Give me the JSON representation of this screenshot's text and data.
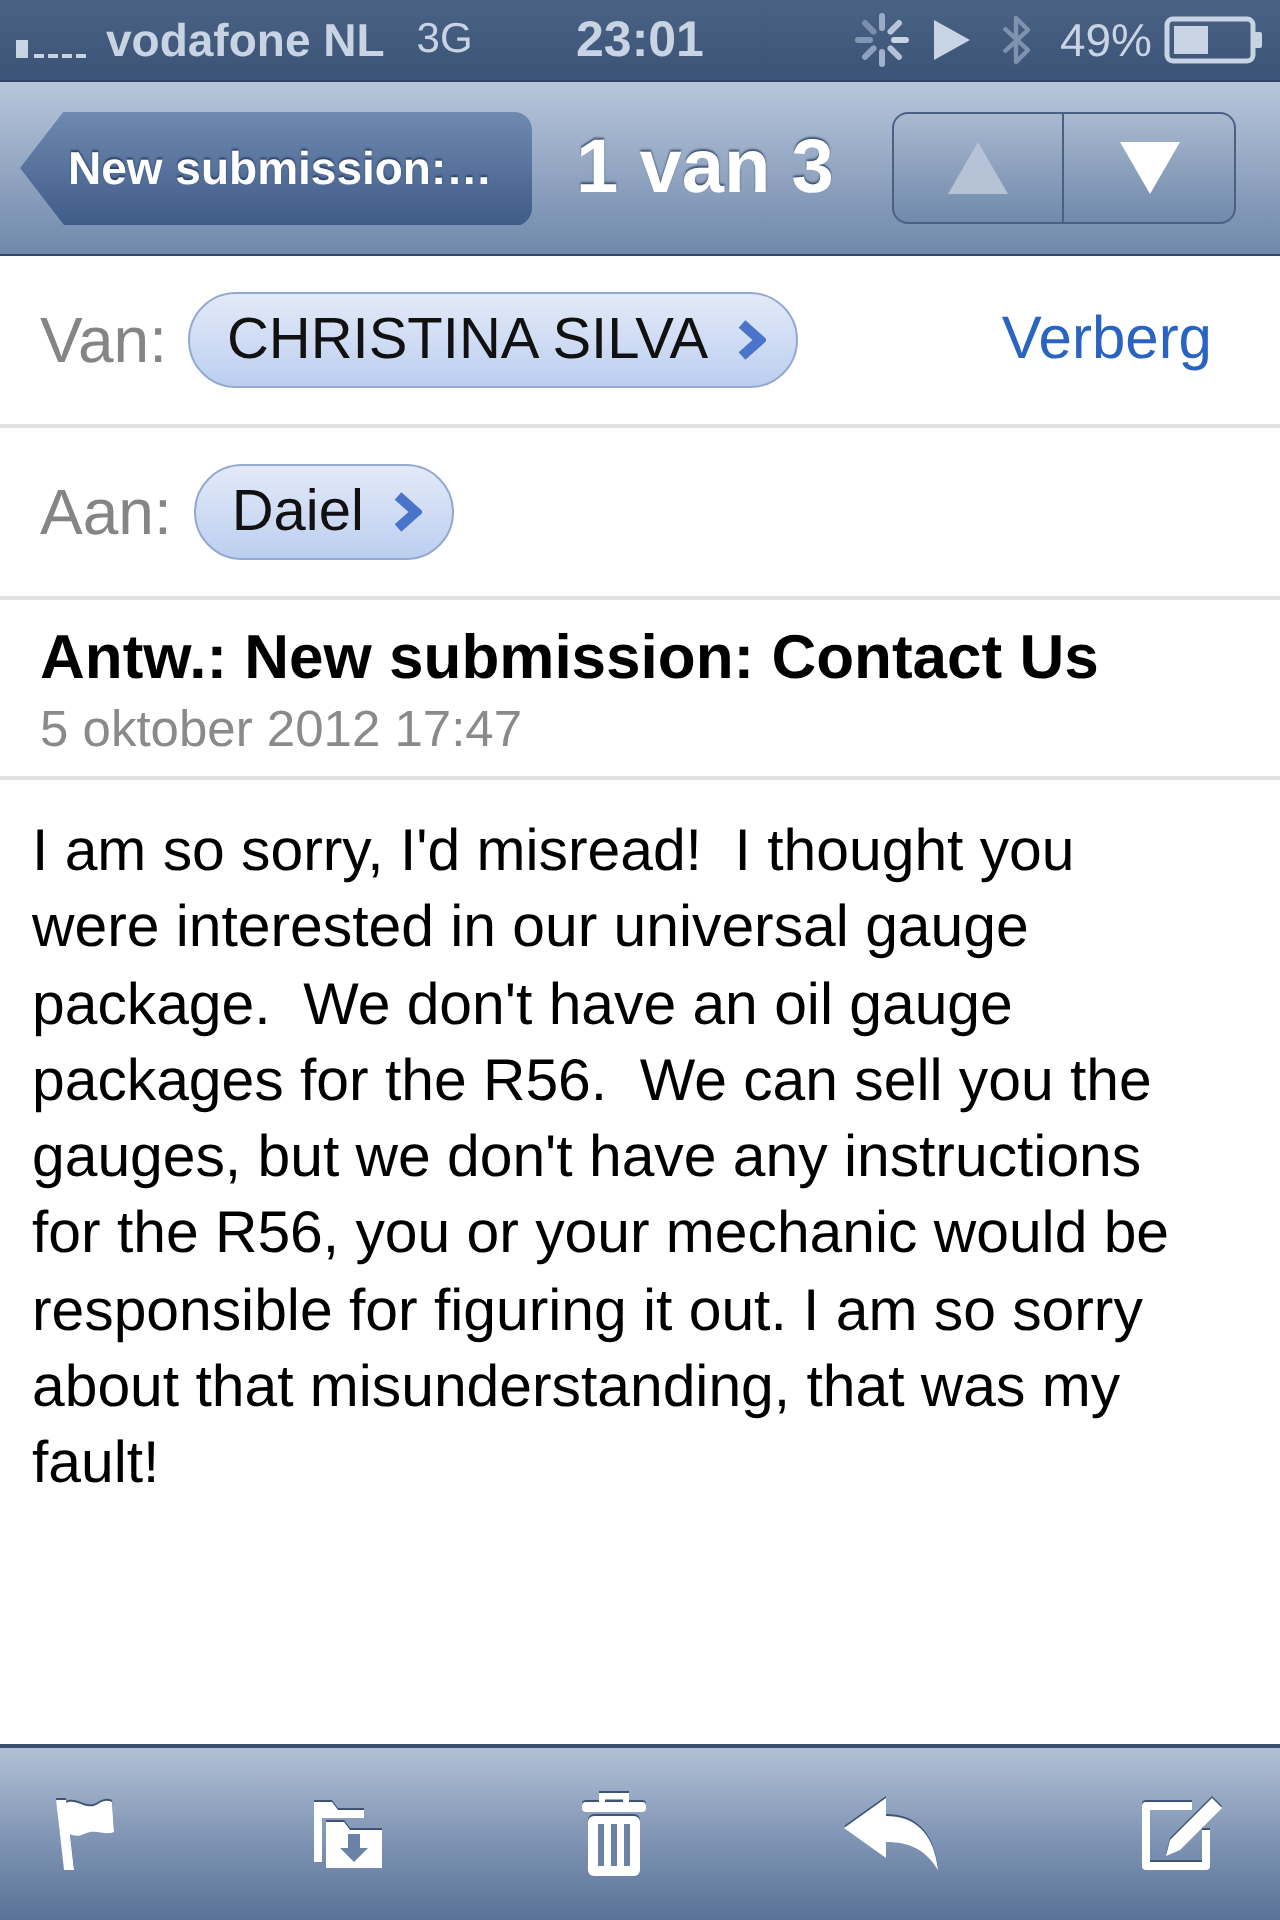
{
  "status_bar": {
    "carrier": "vodafone NL",
    "network": "3G",
    "time": "23:01",
    "battery": "49%"
  },
  "nav_bar": {
    "back_button": "New submission:…",
    "title": "1 van 3",
    "buttons": [
      {
        "kind": "up",
        "disabled": true
      },
      {
        "kind": "down",
        "disabled": false
      }
    ]
  },
  "header": {
    "from": {
      "label": "Van:",
      "name": "CHRISTINA SILVA"
    },
    "hide_link": "Verberg",
    "to": {
      "label": "Aan:",
      "name": "Daiel"
    }
  },
  "message": {
    "subject": "Antw.: New submission: Contact Us",
    "date": "5 oktober 2012 17:47",
    "body": "I am so sorry, I'd misread!  I thought you were interested in our universal gauge package.  We don't have an oil gauge packages for the R56.  We can sell you the gauges, but we don't have any instructions for the R56, you or your mechanic would be responsible for figuring it out. I am so sorry about that misunderstanding, that was my fault!"
  },
  "toolbar": {
    "items": [
      {
        "kind": "flag"
      },
      {
        "kind": "move"
      },
      {
        "kind": "trash"
      },
      {
        "kind": "reply"
      },
      {
        "kind": "compose"
      }
    ]
  }
}
